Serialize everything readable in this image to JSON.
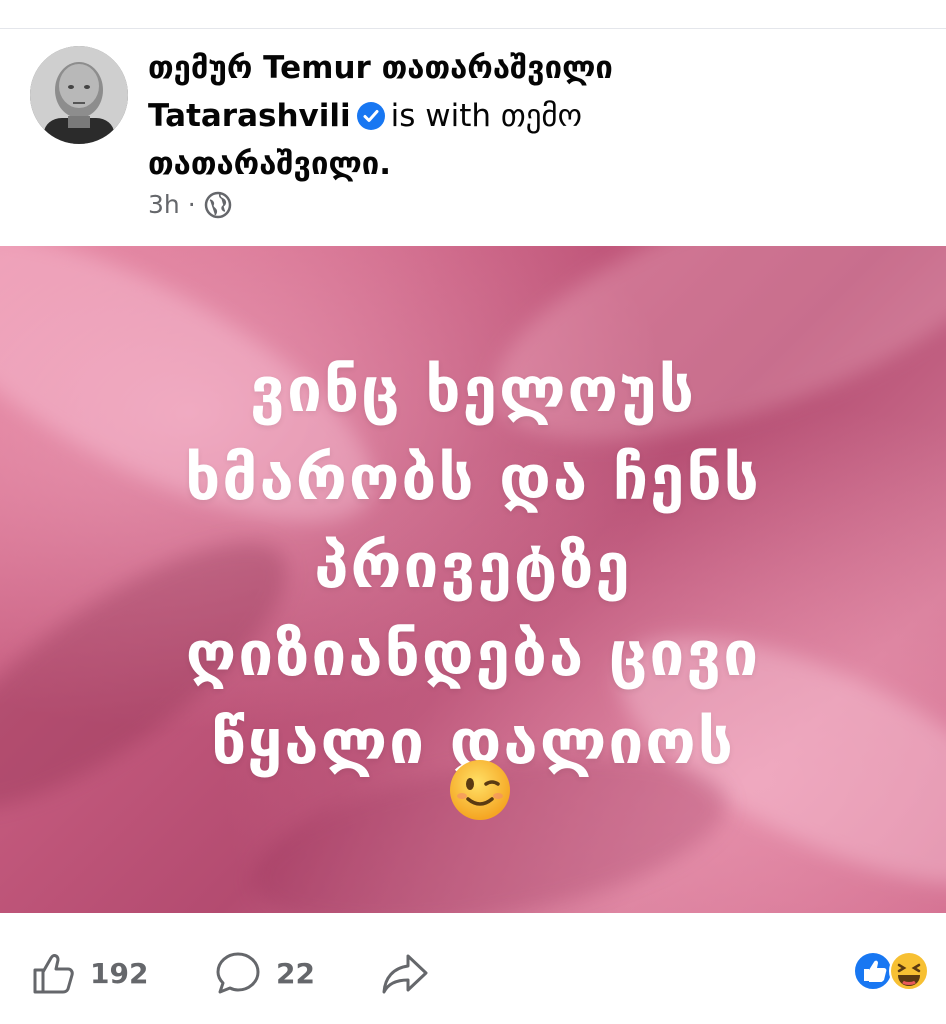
{
  "post": {
    "author_name": "თემურ Temur თათარაშვილი Tatarashvili",
    "with_text": "is with",
    "tagged_name": "თემო თათარაშვილი.",
    "timestamp": "3h",
    "separator": "·",
    "privacy_icon": "globe-icon",
    "image_text_lines": [
      "ვინც ხელოუს",
      "ხმარობს და ჩენს",
      "პრივეტზე",
      "ღიზიანდება ცივი",
      "წყალი დალიოს"
    ],
    "image_emoji": "winking-face",
    "accent_color": "#1877f2"
  },
  "header": {
    "line1_part1": "თემურ Temur თათარაშვილი",
    "line2_name": "Tatarashvili",
    "line2_with": "is with თემო",
    "line3": "თათარაშვილი."
  },
  "actions": {
    "like_count": "192",
    "comment_count": "22",
    "like_icon": "thumbs-up-icon",
    "comment_icon": "comment-icon",
    "share_icon": "share-icon",
    "reaction_icons": [
      "like-reaction-icon",
      "haha-reaction-icon"
    ]
  }
}
